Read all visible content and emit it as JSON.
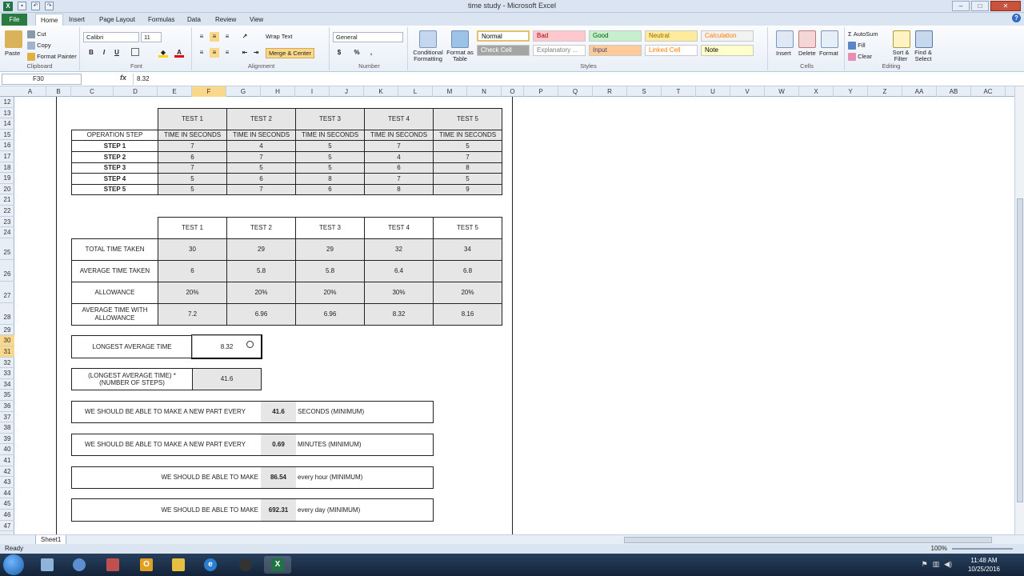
{
  "window": {
    "title": "time study - Microsoft Excel",
    "minimize": "–",
    "maximize": "□",
    "close": "✕"
  },
  "tabs": [
    "File",
    "Home",
    "Insert",
    "Page Layout",
    "Formulas",
    "Data",
    "Review",
    "View"
  ],
  "active_tab": "Home",
  "ribbon": {
    "clipboard": {
      "label": "Clipboard",
      "paste": "Paste",
      "cut": "Cut",
      "copy": "Copy",
      "format_painter": "Format Painter"
    },
    "font": {
      "label": "Font",
      "name": "Calibri",
      "size": "11",
      "bold": "B",
      "italic": "I",
      "underline": "U"
    },
    "alignment": {
      "label": "Alignment",
      "wrap_text": "Wrap Text",
      "merge_center": "Merge & Center"
    },
    "number": {
      "label": "Number",
      "format": "General",
      "currency": "$",
      "percent": "%",
      "comma": ","
    },
    "styles": {
      "label": "Styles",
      "conditional": "Conditional Formatting",
      "format_table": "Format as Table",
      "cells": [
        {
          "name": "Normal",
          "bg": "#ffffff",
          "fg": "#000000"
        },
        {
          "name": "Bad",
          "bg": "#ffc7ce",
          "fg": "#9c0006"
        },
        {
          "name": "Good",
          "bg": "#c6efce",
          "fg": "#006100"
        },
        {
          "name": "Neutral",
          "bg": "#ffeb9c",
          "fg": "#9c6500"
        },
        {
          "name": "Calculation",
          "bg": "#f2f2f2",
          "fg": "#fa7d00"
        },
        {
          "name": "Check Cell",
          "bg": "#a5a5a5",
          "fg": "#ffffff"
        },
        {
          "name": "Explanatory ...",
          "bg": "#ffffff",
          "fg": "#7f7f7f"
        },
        {
          "name": "Input",
          "bg": "#ffcc99",
          "fg": "#3f3f76"
        },
        {
          "name": "Linked Cell",
          "bg": "#ffffff",
          "fg": "#fa7d00"
        },
        {
          "name": "Note",
          "bg": "#ffffcc",
          "fg": "#000000"
        }
      ]
    },
    "cells": {
      "label": "Cells",
      "insert": "Insert",
      "delete": "Delete",
      "format": "Format"
    },
    "editing": {
      "label": "Editing",
      "autosum": "AutoSum",
      "fill": "Fill",
      "clear": "Clear",
      "sort_filter": "Sort & Filter",
      "find_select": "Find & Select"
    }
  },
  "formula_bar": {
    "name_box": "F30",
    "fx": "fx",
    "value": "8.32"
  },
  "columns": [
    "A",
    "B",
    "C",
    "D",
    "E",
    "F",
    "G",
    "H",
    "I",
    "J",
    "K",
    "L",
    "M",
    "N",
    "O",
    "P",
    "Q",
    "R",
    "S",
    "T",
    "U",
    "V",
    "W",
    "X",
    "Y",
    "Z",
    "AA",
    "AB",
    "AC"
  ],
  "rows": [
    "12",
    "13",
    "14",
    "15",
    "16",
    "17",
    "18",
    "19",
    "20",
    "21",
    "22",
    "23",
    "24",
    "25",
    "26",
    "27",
    "28",
    "29",
    "30",
    "31",
    "32",
    "33",
    "34",
    "35",
    "36",
    "37",
    "38",
    "39",
    "40",
    "41",
    "42",
    "43",
    "44",
    "45",
    "46",
    "47"
  ],
  "table1": {
    "tests": [
      "TEST 1",
      "TEST 2",
      "TEST 3",
      "TEST 4",
      "TEST 5"
    ],
    "step_header": "OPERATION STEP",
    "time_header": "TIME  IN SECONDS",
    "steps": [
      {
        "label": "STEP 1",
        "values": [
          "7",
          "4",
          "5",
          "7",
          "5"
        ]
      },
      {
        "label": "STEP 2",
        "values": [
          "6",
          "7",
          "5",
          "4",
          "7"
        ]
      },
      {
        "label": "STEP 3",
        "values": [
          "7",
          "5",
          "5",
          "6",
          "8"
        ]
      },
      {
        "label": "STEP 4",
        "values": [
          "5",
          "6",
          "8",
          "7",
          "5"
        ]
      },
      {
        "label": "STEP 5",
        "values": [
          "5",
          "7",
          "6",
          "8",
          "9"
        ]
      }
    ]
  },
  "table2": {
    "tests": [
      "TEST 1",
      "TEST 2",
      "TEST 3",
      "TEST 4",
      "TEST 5"
    ],
    "rows": [
      {
        "label": "TOTAL TIME TAKEN",
        "values": [
          "30",
          "29",
          "29",
          "32",
          "34"
        ]
      },
      {
        "label": "AVERAGE TIME TAKEN",
        "values": [
          "6",
          "5.8",
          "5.8",
          "6.4",
          "6.8"
        ]
      },
      {
        "label": "ALLOWANCE",
        "values": [
          "20%",
          "20%",
          "20%",
          "30%",
          "20%"
        ]
      },
      {
        "label": "AVERAGE TIME WITH ALLOWANCE",
        "values": [
          "7.2",
          "6.96",
          "6.96",
          "8.32",
          "8.16"
        ]
      }
    ]
  },
  "summary": {
    "longest_label": "LONGEST AVERAGE TIME",
    "longest_value": "8.32",
    "product_label": "(LONGEST AVERAGE TIME) * (NUMBER OF STEPS)",
    "product_value": "41.6"
  },
  "statements": [
    {
      "prefix": "WE SHOULD BE ABLE TO MAKE A NEW PART EVERY",
      "value": "41.6",
      "suffix": "SECONDS (MINIMUM)"
    },
    {
      "prefix": "WE SHOULD BE ABLE TO MAKE A NEW PART EVERY",
      "value": "0.69",
      "suffix": "MINUTES (MINIMUM)"
    },
    {
      "prefix": "WE SHOULD BE ABLE TO MAKE",
      "value": "86.54",
      "suffix": "every hour (MINIMUM)"
    },
    {
      "prefix": "WE SHOULD BE ABLE TO MAKE",
      "value": "692.31",
      "suffix": "every day (MINIMUM)"
    }
  ],
  "sheet_tab": "Sheet1",
  "status": {
    "ready": "Ready",
    "zoom": "100%"
  },
  "taskbar": {
    "time": "11:48 AM",
    "date": "10/25/2016"
  }
}
